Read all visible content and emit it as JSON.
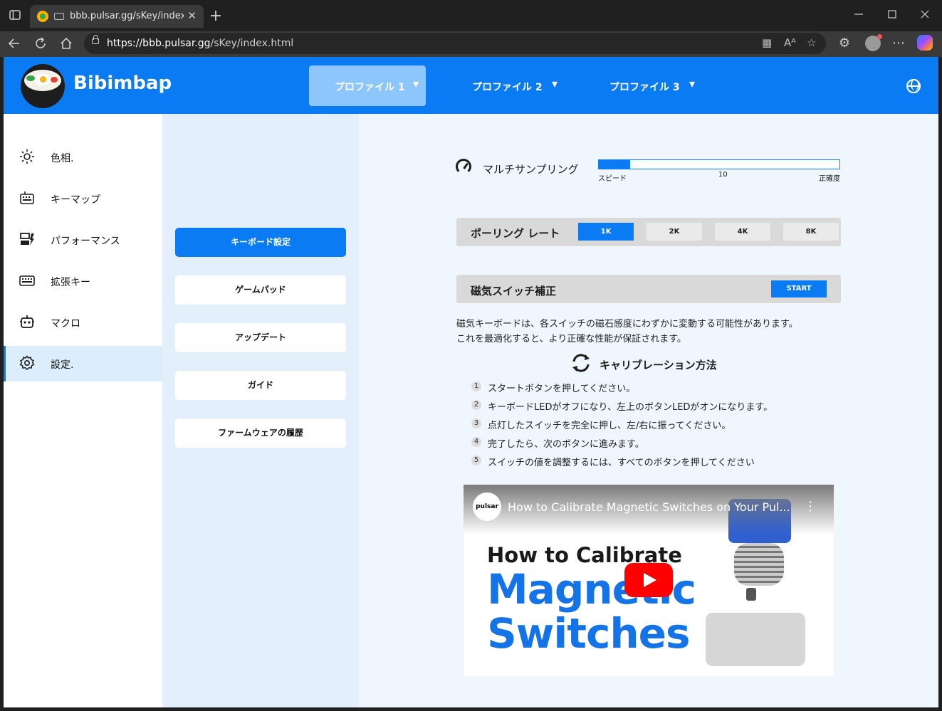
{
  "browser": {
    "tab_title": "bbb.pulsar.gg/sKey/index.htm",
    "tab_close": "✕",
    "new_tab": "+",
    "url_host": "https://bbb.pulsar.gg",
    "url_path": "/sKey/index.html",
    "icons": [
      "sidebar-toggle",
      "back",
      "refresh",
      "home",
      "lock",
      "apps",
      "read-aloud",
      "favorite",
      "extensions",
      "profile",
      "more",
      "copilot"
    ]
  },
  "header": {
    "brand": "Bibimbap",
    "profiles": [
      {
        "label": "プロファイル 1",
        "chev": "⌄"
      },
      {
        "label": "プロファイル 2",
        "chev": "⌄"
      },
      {
        "label": "プロファイル 3",
        "chev": "⌄"
      }
    ],
    "active_profile": 0
  },
  "sidebar": {
    "items": [
      {
        "label": "色相.",
        "icon": "sun-icon"
      },
      {
        "label": "キーマップ",
        "icon": "keyboard-icon"
      },
      {
        "label": "パフォーマンス",
        "icon": "performance-icon"
      },
      {
        "label": "拡張キー",
        "icon": "extended-key-icon"
      },
      {
        "label": "マクロ",
        "icon": "robot-icon"
      },
      {
        "label": "設定.",
        "icon": "gear-icon"
      }
    ],
    "active": 5
  },
  "submenu": {
    "items": [
      "キーボード設定",
      "ゲームパッド",
      "アップデート",
      "ガイド",
      "ファームウェアの履歴"
    ],
    "active": 0
  },
  "settings": {
    "multisampling": {
      "label": "マルチサンプリング",
      "left": "スピード",
      "value": "10",
      "right": "正確度",
      "fill_fraction": 0.13
    },
    "polling": {
      "label": "ポーリング レート",
      "options": [
        "1K",
        "2K",
        "4K",
        "8K"
      ],
      "selected": 0
    },
    "calibration": {
      "label": "磁気スイッチ補正",
      "button": "START",
      "desc1": "磁気キーボードは、各スイッチの磁石感度にわずかに変動する可能性があります。",
      "desc2": "これを最適化すると、より正確な性能が保証されます。",
      "howto_title": "キャリブレーション方法",
      "steps": [
        {
          "n": "1",
          "text": "スタートボタンを押してください。"
        },
        {
          "n": "2",
          "text": "キーボードLEDがオフになり、左上のボタンLEDがオンになります。"
        },
        {
          "n": "3",
          "text": "点灯したスイッチを完全に押し、左/右に振ってください。"
        },
        {
          "n": "4",
          "text": "完了したら、次のボタンに進みます。"
        },
        {
          "n": "5",
          "text": "スイッチの値を調整するには、すべてのボタンを押してください"
        }
      ]
    }
  },
  "video": {
    "channel": "pulsar",
    "title": "How to Calibrate Magnetic Switches on Your Pul...",
    "more": "⋮",
    "thumb_line1": "How to Calibrate",
    "thumb_line2": "Magnetic",
    "thumb_line3": "Switches"
  },
  "colors": {
    "accent": "#0b7bf4",
    "active_tab": "#8cc6fb",
    "bg": "#eff6fd",
    "submenu_bg": "#e3f0fc"
  }
}
